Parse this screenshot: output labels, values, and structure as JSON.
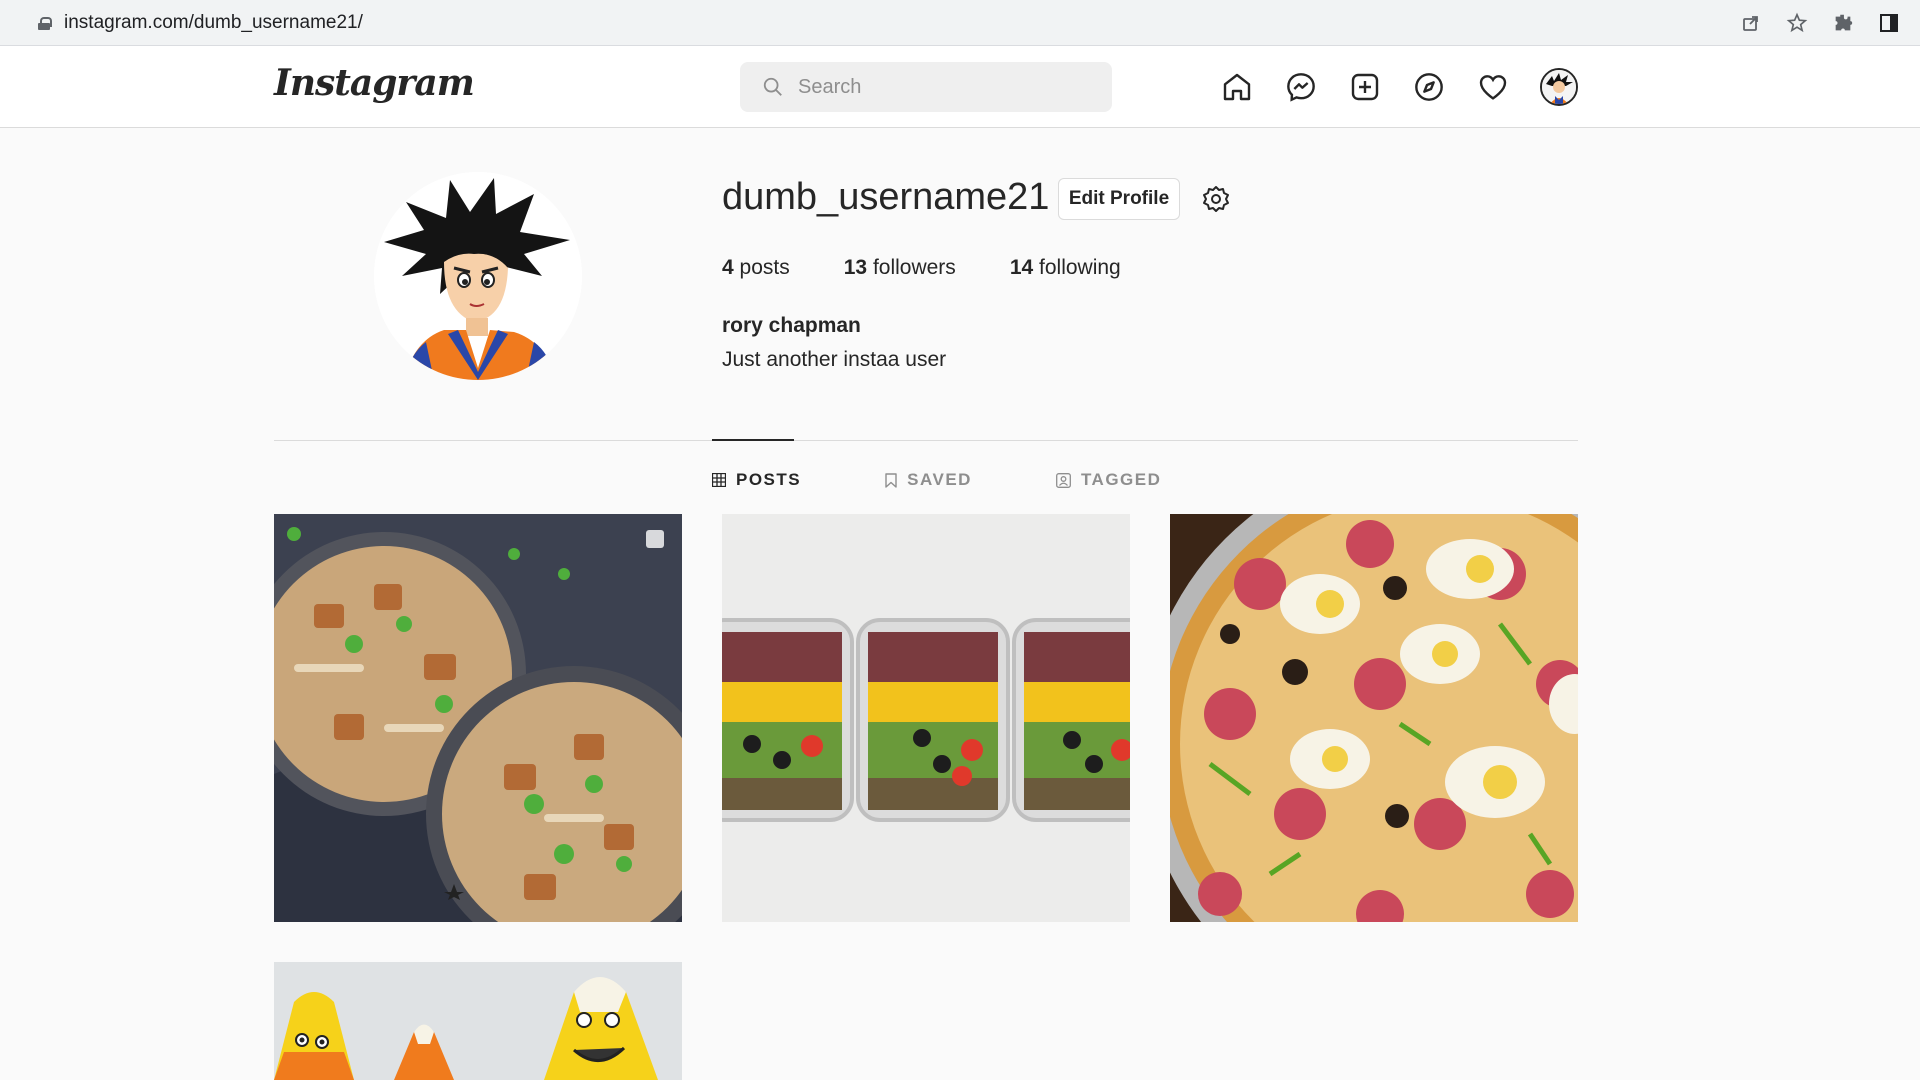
{
  "browser": {
    "url": "instagram.com/dumb_username21/",
    "icons": [
      "lock-icon",
      "share-icon",
      "bookmark-star-icon",
      "extensions-icon",
      "sidebar-icon"
    ]
  },
  "nav": {
    "logo": "Instagram",
    "search_placeholder": "Search",
    "icons": [
      "home-icon",
      "messenger-icon",
      "new-post-icon",
      "explore-icon",
      "activity-heart-icon",
      "profile-avatar"
    ]
  },
  "profile": {
    "username": "dumb_username21",
    "edit_label": "Edit Profile",
    "stats": {
      "posts_count": "4",
      "posts_label": "posts",
      "followers_count": "13",
      "followers_label": "followers",
      "following_count": "14",
      "following_label": "following"
    },
    "full_name": "rory chapman",
    "bio": "Just another instaa user"
  },
  "tabs": [
    {
      "label": "POSTS",
      "active": true
    },
    {
      "label": "SAVED",
      "active": false
    },
    {
      "label": "TAGGED",
      "active": false
    }
  ],
  "posts": [
    {
      "subject": "noodle bowls"
    },
    {
      "subject": "meal prep containers"
    },
    {
      "subject": "pizza with eggs"
    },
    {
      "subject": "candy corn"
    }
  ],
  "colors": {
    "background": "#fafafa",
    "text": "#262626",
    "muted": "#8e8e8e",
    "border": "#dbdbdb"
  }
}
